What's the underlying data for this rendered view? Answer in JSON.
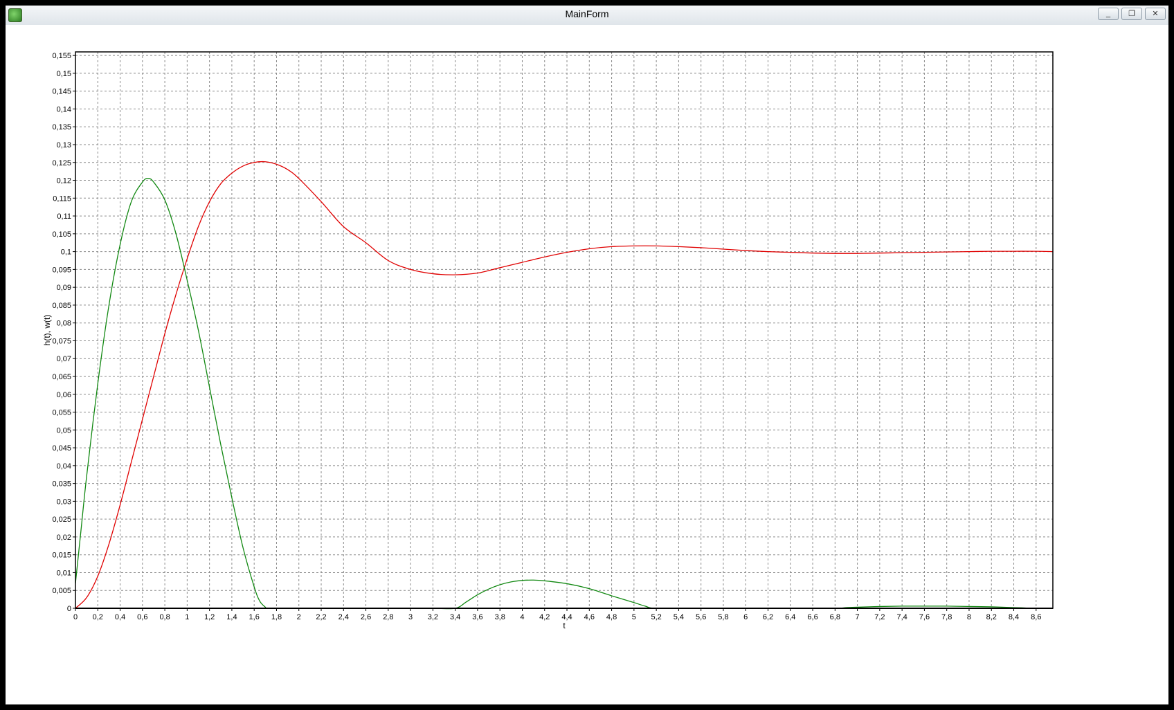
{
  "window": {
    "title": "MainForm",
    "minimize_glyph": "_",
    "restore_glyph": "❐",
    "close_glyph": "✕"
  },
  "chart_data": {
    "type": "line",
    "xlabel": "t",
    "ylabel": "h(t), w(t)",
    "xlim": [
      0,
      8.75
    ],
    "ylim": [
      0,
      0.156
    ],
    "grid": true,
    "x_ticks": [
      "0",
      "0,2",
      "0,4",
      "0,6",
      "0,8",
      "1",
      "1,2",
      "1,4",
      "1,6",
      "1,8",
      "2",
      "2,2",
      "2,4",
      "2,6",
      "2,8",
      "3",
      "3,2",
      "3,4",
      "3,6",
      "3,8",
      "4",
      "4,2",
      "4,4",
      "4,6",
      "4,8",
      "5",
      "5,2",
      "5,4",
      "5,6",
      "5,8",
      "6",
      "6,2",
      "6,4",
      "6,6",
      "6,8",
      "7",
      "7,2",
      "7,4",
      "7,6",
      "7,8",
      "8",
      "8,2",
      "8,4",
      "8,6"
    ],
    "y_ticks": [
      "0",
      "0,005",
      "0,01",
      "0,015",
      "0,02",
      "0,025",
      "0,03",
      "0,035",
      "0,04",
      "0,045",
      "0,05",
      "0,055",
      "0,06",
      "0,065",
      "0,07",
      "0,075",
      "0,08",
      "0,085",
      "0,09",
      "0,095",
      "0,1",
      "0,105",
      "0,11",
      "0,115",
      "0,12",
      "0,125",
      "0,13",
      "0,135",
      "0,14",
      "0,145",
      "0,15",
      "0,155"
    ],
    "series": [
      {
        "color": "#e00000",
        "x": [
          0,
          0.1,
          0.2,
          0.3,
          0.4,
          0.5,
          0.6,
          0.7,
          0.8,
          0.9,
          1.0,
          1.1,
          1.2,
          1.3,
          1.4,
          1.5,
          1.6,
          1.7,
          1.8,
          1.9,
          2.0,
          2.2,
          2.4,
          2.6,
          2.8,
          3.0,
          3.2,
          3.4,
          3.6,
          3.8,
          4.0,
          4.2,
          4.4,
          4.6,
          4.8,
          5.0,
          5.2,
          5.4,
          5.6,
          5.8,
          6.0,
          6.2,
          6.4,
          6.6,
          6.8,
          7.0,
          7.2,
          7.4,
          7.6,
          7.8,
          8.0,
          8.2,
          8.4,
          8.6,
          8.75
        ],
        "y": [
          0,
          0.003,
          0.009,
          0.018,
          0.029,
          0.041,
          0.053,
          0.065,
          0.077,
          0.088,
          0.098,
          0.107,
          0.114,
          0.119,
          0.122,
          0.124,
          0.125,
          0.1252,
          0.1245,
          0.123,
          0.1205,
          0.114,
          0.107,
          0.1025,
          0.0975,
          0.095,
          0.0938,
          0.0935,
          0.094,
          0.0955,
          0.097,
          0.0985,
          0.0998,
          0.1008,
          0.1014,
          0.1016,
          0.1016,
          0.1014,
          0.1011,
          0.1007,
          0.1003,
          0.1,
          0.0998,
          0.0996,
          0.0995,
          0.0995,
          0.0996,
          0.0997,
          0.0998,
          0.0999,
          0.1,
          0.1001,
          0.1001,
          0.1001,
          0.1
        ]
      },
      {
        "color": "#118811",
        "x": [
          0,
          0.05,
          0.1,
          0.2,
          0.3,
          0.4,
          0.5,
          0.6,
          0.65,
          0.7,
          0.8,
          0.9,
          1.0,
          1.1,
          1.2,
          1.3,
          1.4,
          1.5,
          1.6,
          1.65,
          1.7,
          1.71,
          1.8,
          2.0,
          2.4,
          2.8,
          3.2,
          3.4,
          3.5,
          3.6,
          3.7,
          3.8,
          3.9,
          4.0,
          4.1,
          4.2,
          4.4,
          4.6,
          4.8,
          5.0,
          5.1,
          5.2,
          5.6,
          6.0,
          6.4,
          6.8,
          6.9,
          7.0,
          7.2,
          7.4,
          7.6,
          7.8,
          8.0,
          8.2,
          8.4,
          8.5,
          8.6,
          8.75
        ],
        "y": [
          0.007,
          0.022,
          0.037,
          0.063,
          0.085,
          0.102,
          0.114,
          0.1195,
          0.1205,
          0.1195,
          0.1145,
          0.105,
          0.092,
          0.078,
          0.062,
          0.046,
          0.031,
          0.017,
          0.006,
          0.002,
          0.0003,
          0,
          0,
          0,
          0,
          0,
          0,
          0,
          0.0018,
          0.0038,
          0.0054,
          0.0066,
          0.0074,
          0.0078,
          0.0079,
          0.0077,
          0.0069,
          0.0055,
          0.0035,
          0.0016,
          0.0006,
          0,
          0,
          0,
          0,
          0,
          0.0002,
          0.0003,
          0.0005,
          0.0006,
          0.0006,
          0.0006,
          0.0005,
          0.0004,
          0.0002,
          0.0001,
          0,
          0
        ]
      }
    ]
  }
}
